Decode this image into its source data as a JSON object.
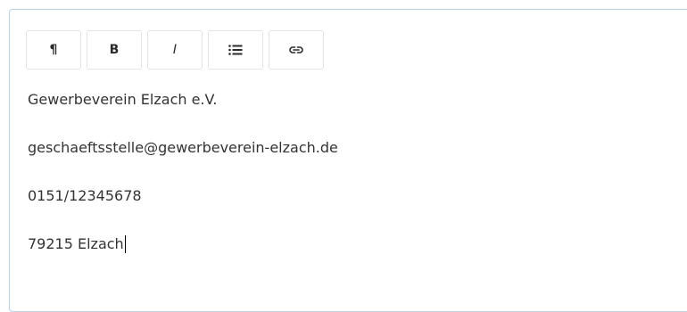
{
  "toolbar": {
    "paragraph_label": "¶",
    "bold_label": "B",
    "italic_label": "I"
  },
  "content": {
    "lines": [
      "Gewerbeverein Elzach e.V.",
      "geschaeftsstelle@gewerbeverein-elzach.de",
      "0151/12345678",
      "79215 Elzach"
    ]
  },
  "colors": {
    "border": "#b9d3ea",
    "button_border": "#e4e4e4",
    "text": "#333333"
  }
}
